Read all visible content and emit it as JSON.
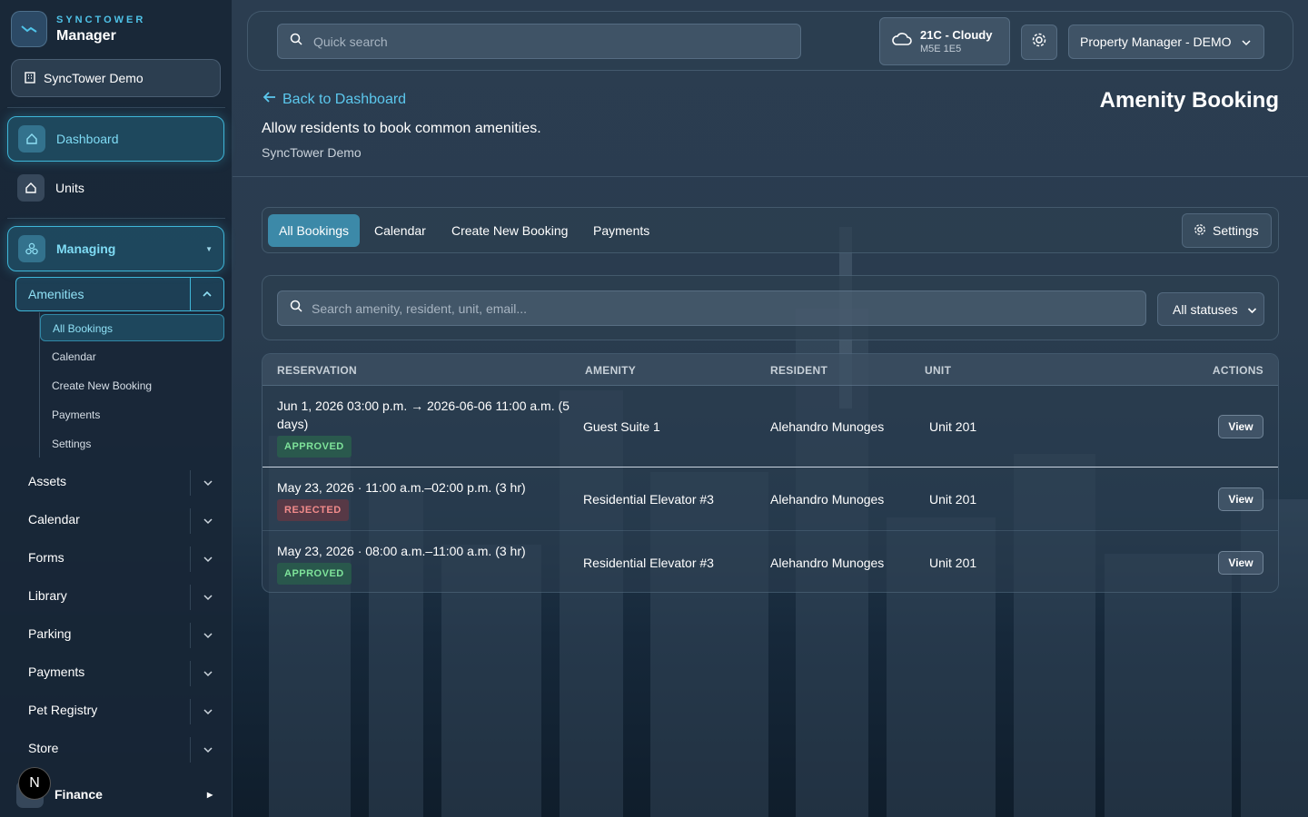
{
  "brand": {
    "top": "SYNCTOWER",
    "sub": "Manager"
  },
  "org_button": "SyncTower Demo",
  "sidebar": {
    "dashboard": "Dashboard",
    "units": "Units",
    "managing": "Managing",
    "amenities": "Amenities",
    "amenity_sub": [
      "All Bookings",
      "Calendar",
      "Create New Booking",
      "Payments",
      "Settings"
    ],
    "sections": [
      "Assets",
      "Calendar",
      "Forms",
      "Library",
      "Parking",
      "Payments",
      "Pet Registry",
      "Store"
    ],
    "finance": "Finance",
    "avatar_letter": "N"
  },
  "topbar": {
    "search_placeholder": "Quick search",
    "weather_main": "21C - Cloudy",
    "weather_sub": "M5E 1E5",
    "user_menu": "Property Manager - DEMO"
  },
  "header": {
    "back": "Back to Dashboard",
    "title": "Amenity Booking",
    "description": "Allow residents to book common amenities.",
    "org": "SyncTower Demo"
  },
  "tabs": [
    "All Bookings",
    "Calendar",
    "Create New Booking",
    "Payments"
  ],
  "tabs_settings": "Settings",
  "filters": {
    "search_placeholder": "Search amenity, resident, unit, email...",
    "status": "All statuses"
  },
  "table": {
    "headers": [
      "RESERVATION",
      "AMENITY",
      "RESIDENT",
      "UNIT",
      "ACTIONS"
    ],
    "rows": [
      {
        "reservation": "Jun 1, 2026 03:00 p.m. → 2026-06-06 11:00 a.m. (5 days)",
        "status": "APPROVED",
        "amenity": "Guest Suite 1",
        "resident": "Alehandro Munoges",
        "unit": "Unit 201",
        "action": "View"
      },
      {
        "reservation": "May 23, 2026 · 11:00 a.m.–02:00 p.m. (3 hr)",
        "status": "REJECTED",
        "amenity": "Residential Elevator #3",
        "resident": "Alehandro Munoges",
        "unit": "Unit 201",
        "action": "View"
      },
      {
        "reservation": "May 23, 2026 · 08:00 a.m.–11:00 a.m. (3 hr)",
        "status": "APPROVED",
        "amenity": "Residential Elevator #3",
        "resident": "Alehandro Munoges",
        "unit": "Unit 201",
        "action": "View"
      }
    ]
  },
  "colors": {
    "accent": "#3fb6d8",
    "approved": "#7ee39a",
    "rejected": "#f28b8b"
  }
}
